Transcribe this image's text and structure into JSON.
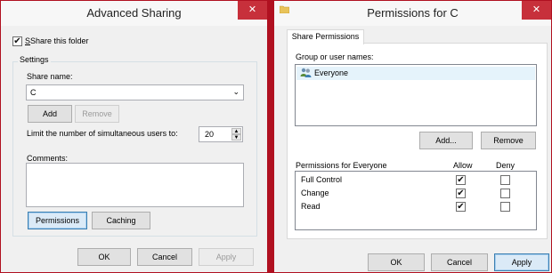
{
  "advanced_sharing": {
    "title": "Advanced Sharing",
    "close": "✕",
    "share_checkbox": {
      "label": "Share this folder",
      "checked": true
    },
    "settings_label": "Settings",
    "share_name_label": "Share name:",
    "share_name_value": "C",
    "add_label": "Add",
    "remove_label": "Remove",
    "limit_label": "Limit the number of simultaneous users to:",
    "limit_value": "20",
    "comments_label": "Comments:",
    "comments_value": "",
    "permissions_label": "Permissions",
    "caching_label": "Caching",
    "ok_label": "OK",
    "cancel_label": "Cancel",
    "apply_label": "Apply"
  },
  "permissions": {
    "title": "Permissions for C",
    "close": "✕",
    "tab_label": "Share Permissions",
    "group_label": "Group or user names:",
    "users": [
      {
        "name": "Everyone",
        "icon": "users-group-icon"
      }
    ],
    "add_label": "Add...",
    "remove_label": "Remove",
    "perm_header": "Permissions for Everyone",
    "allow_label": "Allow",
    "deny_label": "Deny",
    "rows": [
      {
        "name": "Full Control",
        "allow": true,
        "deny": false
      },
      {
        "name": "Change",
        "allow": true,
        "deny": false
      },
      {
        "name": "Read",
        "allow": true,
        "deny": false
      }
    ],
    "ok_label": "OK",
    "cancel_label": "Cancel",
    "apply_label": "Apply"
  }
}
